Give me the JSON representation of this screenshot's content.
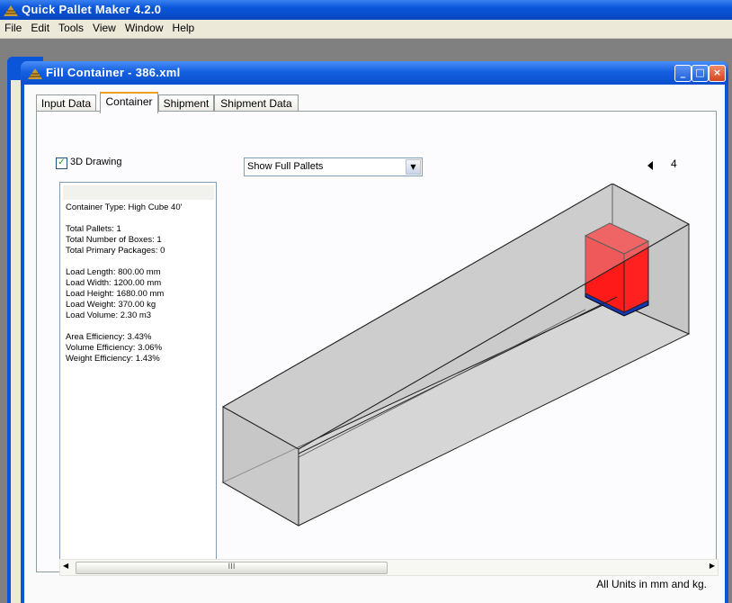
{
  "app": {
    "title": "Quick Pallet Maker 4.2.0",
    "menu": [
      "File",
      "Edit",
      "Tools",
      "View",
      "Window",
      "Help"
    ]
  },
  "child": {
    "title": "Fill Container - 386.xml",
    "buttons": {
      "minimize": "_",
      "maximize": "□",
      "close": "×"
    }
  },
  "tabs": [
    "Input Data",
    "Container",
    "Shipment",
    "Shipment Data"
  ],
  "active_tab": "Container",
  "controls": {
    "drawing_label": "3D Drawing",
    "drawing_checked": true,
    "show_select": "Show Full Pallets",
    "count": "4"
  },
  "info": {
    "lines": [
      "Container Type: High Cube 40'",
      "",
      "Total Pallets: 1",
      "Total Number of Boxes: 1",
      "Total Primary Packages: 0",
      "",
      "Load Length: 800.00 mm",
      "Load Width: 1200.00 mm",
      "Load Height: 1680.00 mm",
      "Load Weight: 370.00 kg",
      "Load Volume: 2.30 m3",
      "",
      "Area Efficiency: 3.43%",
      "Volume Efficiency: 3.06%",
      "Weight Efficiency: 1.43%"
    ]
  },
  "scrollbar": {
    "thumb_grip": "III"
  },
  "status": "All Units in mm and kg.",
  "colors": {
    "title_blue": "#0a55d8",
    "box_red": "#ff1a1a",
    "pallet_blue": "#1838b0",
    "container_gray": "#d0d0d0"
  }
}
